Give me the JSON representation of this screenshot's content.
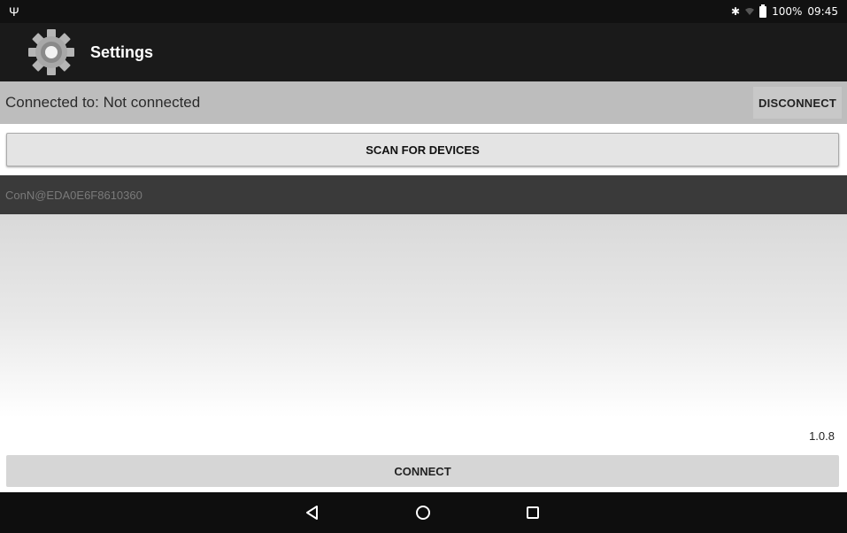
{
  "status_bar": {
    "usb_icon": "usb-icon",
    "bluetooth_icon": "bluetooth-icon",
    "battery_text": "100%",
    "time": "09:45"
  },
  "action_bar": {
    "title": "Settings",
    "icon": "gear-icon"
  },
  "connection": {
    "status_text": "Connected to: Not connected",
    "disconnect_label": "DISCONNECT"
  },
  "scan_label": "SCAN FOR DEVICES",
  "devices": [
    {
      "name": "ConN@EDA0E6F8610360"
    }
  ],
  "version": "1.0.8",
  "connect_label": "CONNECT",
  "nav": {
    "back_icon": "back-icon",
    "home_icon": "home-icon",
    "recents_icon": "recents-icon"
  }
}
